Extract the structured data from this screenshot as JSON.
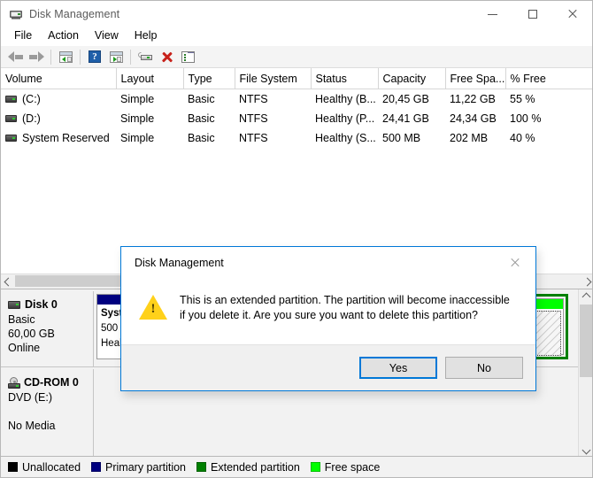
{
  "window": {
    "title": "Disk Management",
    "icon": "disk-management-icon",
    "controls": {
      "minimize": "minimize",
      "maximize": "maximize",
      "close": "close"
    }
  },
  "menubar": {
    "items": [
      "File",
      "Action",
      "View",
      "Help"
    ]
  },
  "toolbar": {
    "items": [
      {
        "name": "back-icon",
        "label": "Back"
      },
      {
        "name": "forward-icon",
        "label": "Forward"
      },
      {
        "name": "show-hide-console-tree-icon",
        "label": "Show/Hide Console Tree"
      },
      {
        "name": "help-icon",
        "label": "Help"
      },
      {
        "name": "show-hide-action-pane-icon",
        "label": "Show/Hide Action Pane"
      },
      {
        "name": "rescan-disks-icon",
        "label": "Rescan Disks"
      },
      {
        "name": "delete-volume-icon",
        "label": "Delete Volume"
      },
      {
        "name": "properties-icon",
        "label": "Properties"
      }
    ]
  },
  "volume_list": {
    "columns": [
      "Volume",
      "Layout",
      "Type",
      "File System",
      "Status",
      "Capacity",
      "Free Spa...",
      "% Free"
    ],
    "rows": [
      {
        "volume": "(C:)",
        "layout": "Simple",
        "type": "Basic",
        "file_system": "NTFS",
        "status": "Healthy (B...",
        "capacity": "20,45 GB",
        "free_space": "11,22 GB",
        "percent_free": "55 %"
      },
      {
        "volume": "(D:)",
        "layout": "Simple",
        "type": "Basic",
        "file_system": "NTFS",
        "status": "Healthy (P...",
        "capacity": "24,41 GB",
        "free_space": "24,34 GB",
        "percent_free": "100 %"
      },
      {
        "volume": "System Reserved",
        "layout": "Simple",
        "type": "Basic",
        "file_system": "NTFS",
        "status": "Healthy (S...",
        "capacity": "500 MB",
        "free_space": "202 MB",
        "percent_free": "40 %"
      }
    ]
  },
  "disk_pane": {
    "disks": [
      {
        "name": "Disk 0",
        "type": "Basic",
        "size": "60,00 GB",
        "state": "Online",
        "partitions": [
          {
            "kind": "primary",
            "label": "System Reserved",
            "size": "500 MB NTFS",
            "status": "Healthy (System, Active, Primary Partition)"
          },
          {
            "kind": "extended",
            "label": "Free space",
            "selected": true
          }
        ]
      },
      {
        "name": "CD-ROM 0",
        "type": "DVD (E:)",
        "size": "",
        "state": "No Media",
        "partitions": []
      }
    ]
  },
  "legend": {
    "items": [
      {
        "label": "Unallocated",
        "color": "#000000"
      },
      {
        "label": "Primary partition",
        "color": "#000080"
      },
      {
        "label": "Extended partition",
        "color": "#008000"
      },
      {
        "label": "Free space",
        "color": "#00ff00"
      }
    ]
  },
  "dialog": {
    "title": "Disk Management",
    "message": "This is an extended partition. The partition will become inaccessible if you delete it. Are you sure you want to delete this partition?",
    "icon": "warning-icon",
    "buttons": {
      "yes": "Yes",
      "no": "No"
    },
    "close": "close"
  },
  "colors": {
    "accent": "#0078d7",
    "primary_partition": "#000080",
    "extended_partition": "#008000",
    "free_space": "#00ff00",
    "unallocated": "#000000",
    "warning": "#ffd11a"
  }
}
